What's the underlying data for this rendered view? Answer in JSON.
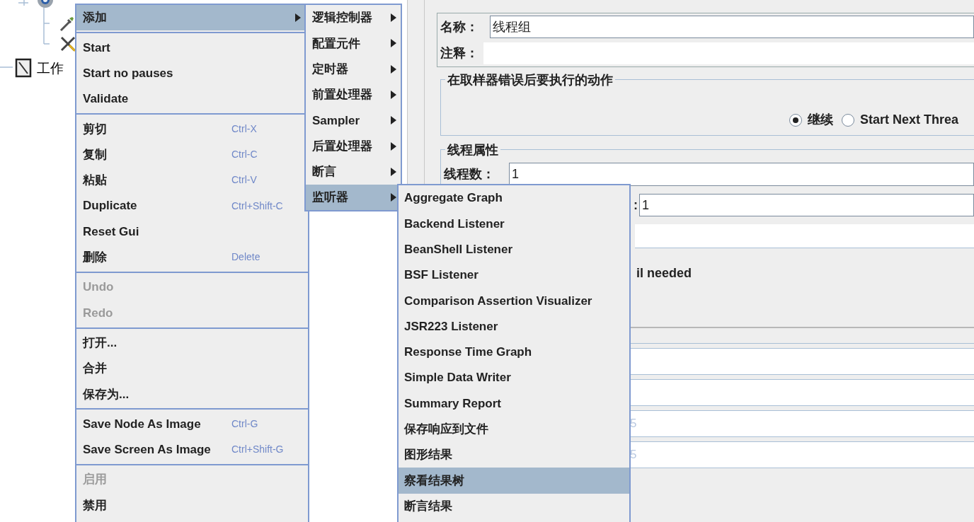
{
  "tree": {
    "items": [
      {
        "label": "工作"
      }
    ]
  },
  "panel": {
    "name_field": {
      "label": "名称：",
      "value": "线程组"
    },
    "comment_field": {
      "label": "注释："
    },
    "error_action": {
      "title": "在取样器错误后要执行的动作",
      "options": [
        {
          "label": "继续",
          "selected": true
        },
        {
          "label": "Start Next Threa",
          "selected": false
        }
      ]
    },
    "thread_properties": {
      "title": "线程属性",
      "fields": [
        {
          "label": "线程数：",
          "value": "1"
        },
        {
          "label": ":",
          "value": "1"
        }
      ],
      "note": "il needed",
      "disabled_values": [
        "5",
        "5"
      ]
    }
  },
  "context_menu": {
    "items": [
      {
        "kind": "item",
        "label": "添加",
        "submenu": true,
        "selected": true,
        "disabled": false
      },
      {
        "kind": "separator"
      },
      {
        "kind": "item",
        "label": "Start",
        "submenu": false,
        "selected": false,
        "disabled": false
      },
      {
        "kind": "item",
        "label": "Start no pauses",
        "submenu": false,
        "selected": false,
        "disabled": false
      },
      {
        "kind": "item",
        "label": "Validate",
        "submenu": false,
        "selected": false,
        "disabled": false
      },
      {
        "kind": "separator"
      },
      {
        "kind": "item",
        "label": "剪切",
        "shortcut": "Ctrl-X",
        "submenu": false,
        "selected": false,
        "disabled": false
      },
      {
        "kind": "item",
        "label": "复制",
        "shortcut": "Ctrl-C",
        "submenu": false,
        "selected": false,
        "disabled": false
      },
      {
        "kind": "item",
        "label": "粘贴",
        "shortcut": "Ctrl-V",
        "submenu": false,
        "selected": false,
        "disabled": false
      },
      {
        "kind": "item",
        "label": "Duplicate",
        "shortcut": "Ctrl+Shift-C",
        "submenu": false,
        "selected": false,
        "disabled": false
      },
      {
        "kind": "item",
        "label": "Reset Gui",
        "submenu": false,
        "selected": false,
        "disabled": false
      },
      {
        "kind": "item",
        "label": "删除",
        "shortcut": "Delete",
        "submenu": false,
        "selected": false,
        "disabled": false
      },
      {
        "kind": "separator"
      },
      {
        "kind": "item",
        "label": "Undo",
        "submenu": false,
        "selected": false,
        "disabled": true
      },
      {
        "kind": "item",
        "label": "Redo",
        "submenu": false,
        "selected": false,
        "disabled": true
      },
      {
        "kind": "separator"
      },
      {
        "kind": "item",
        "label": "打开...",
        "submenu": false,
        "selected": false,
        "disabled": false
      },
      {
        "kind": "item",
        "label": "合并",
        "submenu": false,
        "selected": false,
        "disabled": false
      },
      {
        "kind": "item",
        "label": "保存为...",
        "submenu": false,
        "selected": false,
        "disabled": false
      },
      {
        "kind": "separator"
      },
      {
        "kind": "item",
        "label": "Save Node As Image",
        "shortcut": "Ctrl-G",
        "submenu": false,
        "selected": false,
        "disabled": false
      },
      {
        "kind": "item",
        "label": "Save Screen As Image",
        "shortcut": "Ctrl+Shift-G",
        "submenu": false,
        "selected": false,
        "disabled": false
      },
      {
        "kind": "separator"
      },
      {
        "kind": "item",
        "label": "启用",
        "submenu": false,
        "selected": false,
        "disabled": true
      },
      {
        "kind": "item",
        "label": "禁用",
        "submenu": false,
        "selected": false,
        "disabled": false
      }
    ]
  },
  "add_submenu": {
    "items": [
      {
        "kind": "item",
        "label": "逻辑控制器",
        "submenu": true,
        "selected": false,
        "disabled": false
      },
      {
        "kind": "item",
        "label": "配置元件",
        "submenu": true,
        "selected": false,
        "disabled": false
      },
      {
        "kind": "item",
        "label": "定时器",
        "submenu": true,
        "selected": false,
        "disabled": false
      },
      {
        "kind": "item",
        "label": "前置处理器",
        "submenu": true,
        "selected": false,
        "disabled": false
      },
      {
        "kind": "item",
        "label": "Sampler",
        "submenu": true,
        "selected": false,
        "disabled": false
      },
      {
        "kind": "item",
        "label": "后置处理器",
        "submenu": true,
        "selected": false,
        "disabled": false
      },
      {
        "kind": "item",
        "label": "断言",
        "submenu": true,
        "selected": false,
        "disabled": false
      },
      {
        "kind": "item",
        "label": "监听器",
        "submenu": true,
        "selected": true,
        "disabled": false
      }
    ]
  },
  "listener_submenu": {
    "items": [
      {
        "kind": "item",
        "label": "Aggregate Graph",
        "submenu": false,
        "selected": false,
        "disabled": false
      },
      {
        "kind": "item",
        "label": "Backend Listener",
        "submenu": false,
        "selected": false,
        "disabled": false
      },
      {
        "kind": "item",
        "label": "BeanShell Listener",
        "submenu": false,
        "selected": false,
        "disabled": false
      },
      {
        "kind": "item",
        "label": "BSF Listener",
        "submenu": false,
        "selected": false,
        "disabled": false
      },
      {
        "kind": "item",
        "label": "Comparison Assertion Visualizer",
        "submenu": false,
        "selected": false,
        "disabled": false
      },
      {
        "kind": "item",
        "label": "JSR223 Listener",
        "submenu": false,
        "selected": false,
        "disabled": false
      },
      {
        "kind": "item",
        "label": "Response Time Graph",
        "submenu": false,
        "selected": false,
        "disabled": false
      },
      {
        "kind": "item",
        "label": "Simple Data Writer",
        "submenu": false,
        "selected": false,
        "disabled": false
      },
      {
        "kind": "item",
        "label": "Summary Report",
        "submenu": false,
        "selected": false,
        "disabled": false
      },
      {
        "kind": "item",
        "label": "保存响应到文件",
        "submenu": false,
        "selected": false,
        "disabled": false
      },
      {
        "kind": "item",
        "label": "图形结果",
        "submenu": false,
        "selected": false,
        "disabled": false
      },
      {
        "kind": "item",
        "label": "察看结果树",
        "submenu": false,
        "selected": true,
        "disabled": false
      },
      {
        "kind": "item",
        "label": "断言结果",
        "submenu": false,
        "selected": false,
        "disabled": false
      }
    ]
  }
}
